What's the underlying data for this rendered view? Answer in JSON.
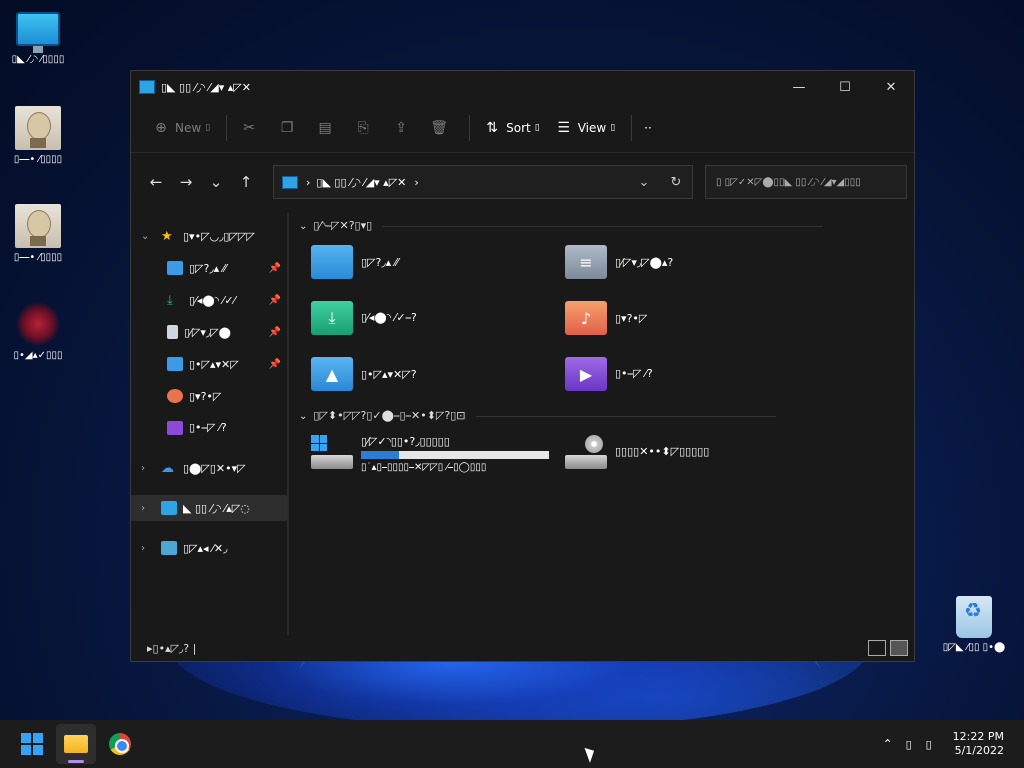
{
  "desktop": {
    "icons": [
      {
        "label": "▯◣ ⁄◞◝ ⁄▯▯▯▯",
        "icon": "this-pc-icon"
      },
      {
        "label": "▯⎯⎯• ⁄▯▯▯▯",
        "icon": "image-file-icon"
      },
      {
        "label": "▯⎯⎯• ⁄▯▯▯▯",
        "icon": "image-file-icon"
      },
      {
        "label": "▯•◢▴✓▯▯▯",
        "icon": "shortcut-icon"
      },
      {
        "label": "▯◸◣ ⁄▯▯ ▯•⬤",
        "icon": "recycle-bin-icon"
      }
    ]
  },
  "window": {
    "title": "▯◣ ▯▯ ⁄◞◝ ⁄◢▾ ▴◸✕",
    "controls": {
      "minimize": "—",
      "maximize": "☐",
      "close": "✕"
    },
    "toolbar": {
      "new_label": "New",
      "new_caret": "▯",
      "sort_label": "Sort",
      "sort_caret": "▯",
      "view_label": "View",
      "view_caret": "▯",
      "more_label": "··"
    },
    "address": {
      "path": "▯◣ ▯▯ ⁄◞◝ ⁄◢▾ ▴◸✕",
      "sep1": "›",
      "sep2": "›",
      "dropdown": "⌄",
      "refresh": "↻"
    },
    "search_placeholder": "▯ ▯◸✓✕◸⬤▯▯◣ ▯▯ ⁄◞◝ ⁄◢▾◢▯▯▯",
    "sidebar": {
      "quick_access": "▯▾•◸◡◞▯◸◸◸",
      "items": [
        {
          "label": "▯◸?◞▴ ⁄⁄",
          "icon": "desktop-folder-icon",
          "pinned": "📌"
        },
        {
          "label": "▯⁄◂⬤◝ ⁄✓⁄",
          "icon": "download-icon",
          "pinned": "📌"
        },
        {
          "label": "▯⁄◸▾◞◸⬤",
          "icon": "document-icon",
          "pinned": "📌"
        },
        {
          "label": "▯•◸▴▾✕◸",
          "icon": "pictures-icon",
          "pinned": "📌"
        },
        {
          "label": "▯▾?•◸",
          "icon": "music-icon",
          "pinned": ""
        },
        {
          "label": "▯•⎯◸ ⁄?",
          "icon": "videos-icon",
          "pinned": ""
        }
      ],
      "onedrive": "▯⬤◸▯✕•▾◸",
      "this_pc": "◣ ▯▯ ⁄◞◝ ⁄▴◸◌",
      "network": "▯◸▴◂ ⁄✕◞"
    },
    "content": {
      "folders_header": "▯⁄◝⎯◸✕?▯▾▯",
      "folders": [
        {
          "label": "▯◸?◞▴ ⁄⁄",
          "icon": "desktop-folder-icon"
        },
        {
          "label": "▯⁄◸▾◞◸⬤▴?",
          "icon": "documents-folder-icon"
        },
        {
          "label": "▯⁄◂⬤◝ ⁄✓⎯?",
          "icon": "downloads-folder-icon"
        },
        {
          "label": "▯▾?•◸",
          "icon": "music-folder-icon"
        },
        {
          "label": "▯•◸▴▾✕◸?",
          "icon": "pictures-folder-icon"
        },
        {
          "label": "▯•⎯◸ ⁄?",
          "icon": "videos-folder-icon"
        }
      ],
      "drives_header": "▯◸⬍•◸◸?▯✓⬤⎯▯⎯✕•⬍◸?▯⊡",
      "drives": [
        {
          "label": "▯⁄◸✓◝▯▯•?◞▯▯▯▯▯",
          "detail": "▯˙▴▯⎯▯▯▯▯⎯✕◸◸▯ ⁄⎯▯◯▯▯▯",
          "used_fraction": 0.2,
          "icon": "system-drive-icon"
        },
        {
          "label": "▯▯▯▯✕••⬍◸▯▯▯▯▯",
          "detail": "",
          "icon": "dvd-drive-icon"
        }
      ]
    },
    "status": {
      "items": "▸▯•▴◸◞?  |"
    }
  },
  "taskbar": {
    "apps": [
      {
        "name": "start",
        "icon": "windows-logo-icon"
      },
      {
        "name": "file-explorer",
        "icon": "file-explorer-icon",
        "active": true
      },
      {
        "name": "chrome",
        "icon": "chrome-icon"
      }
    ],
    "tray_chevron": "⌃",
    "tray_net": "▯",
    "tray_vol": "▯",
    "time": "12:22 PM",
    "date": "5/1/2022"
  }
}
